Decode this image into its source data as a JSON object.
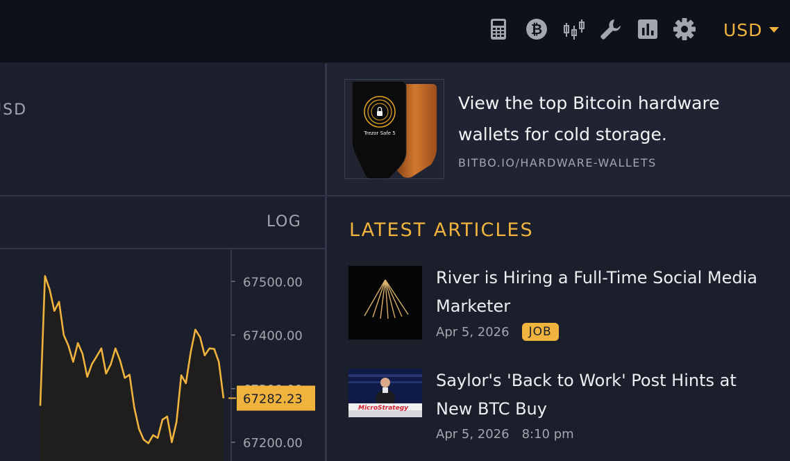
{
  "header": {
    "icons": [
      "calculator-icon",
      "bitcoin-icon",
      "candlestick-icon",
      "wrench-icon",
      "bar-chart-icon",
      "gear-icon"
    ],
    "currency": "USD"
  },
  "price_panel": {
    "currency_partial": "USD"
  },
  "chart": {
    "scale_toggle": "LOG",
    "y_ticks": [
      "67500.00",
      "67400.00",
      "67300.00",
      "67200.00"
    ],
    "current_price": "67282.23",
    "accent": "#f0b33d"
  },
  "ad": {
    "device_label": "Trezor Safe 5",
    "title": "View the top Bitcoin hardware wallets for cold storage.",
    "url": "BITBO.IO/HARDWARE-WALLETS"
  },
  "articles": {
    "heading": "LATEST ARTICLES",
    "items": [
      {
        "title": "River is Hiring a Full-Time Social Media Marketer",
        "date": "Apr 5, 2026",
        "tag": "JOB"
      },
      {
        "title": "Saylor's 'Back to Work' Post Hints at New BTC Buy",
        "date": "Apr 5, 2026",
        "time": "8:10 pm",
        "banner": "MicroStrategy"
      }
    ]
  },
  "chart_data": {
    "type": "line",
    "y": [
      67268,
      67510,
      67485,
      67445,
      67462,
      67400,
      67380,
      67350,
      67385,
      67365,
      67322,
      67346,
      67360,
      67375,
      67328,
      67345,
      67375,
      67352,
      67320,
      67326,
      67265,
      67225,
      67205,
      67198,
      67213,
      67208,
      67242,
      67248,
      67200,
      67238,
      67325,
      67310,
      67367,
      67410,
      67396,
      67362,
      67375,
      67374,
      67350,
      67282
    ],
    "ylim": [
      67165,
      67560
    ],
    "ticks": [
      67500,
      67400,
      67300,
      67200
    ],
    "current": 67282.23
  }
}
